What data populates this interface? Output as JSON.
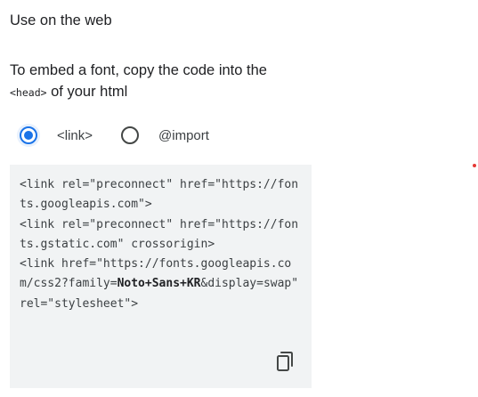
{
  "section": {
    "title": "Use on the web"
  },
  "description": {
    "line1": "To embed a font, copy the code into the",
    "code_tag": "<head>",
    "line2_suffix": " of your html"
  },
  "embed_options": [
    {
      "label": "<link>",
      "selected": true
    },
    {
      "label": "@import",
      "selected": false
    }
  ],
  "code": {
    "part_before_family": "<link rel=\"preconnect\" href=\"https://fonts.googleapis.com\">\n<link rel=\"preconnect\" href=\"https://fonts.gstatic.com\" crossorigin>\n<link href=\"https://fonts.googleapis.com/css2?family=",
    "family": "Noto+Sans+KR",
    "part_after_family": "&display=swap\" rel=\"stylesheet\">"
  },
  "icons": {
    "copy": "copy-icon"
  },
  "colors": {
    "accent": "#1a73e8",
    "code_background": "#f1f3f4",
    "marker": "#e53935"
  }
}
